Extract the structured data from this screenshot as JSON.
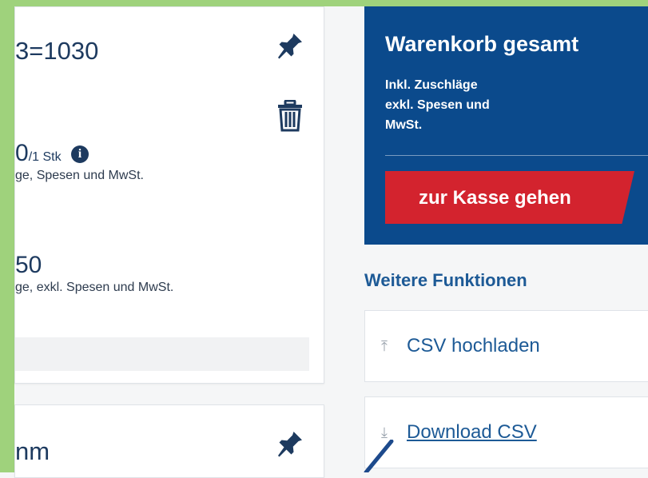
{
  "article_card": {
    "title": "3=1030",
    "unit_price_main": "0",
    "unit_price_unit": "/1 Stk",
    "unit_price_note": "ge, Spesen und MwSt.",
    "total_price": "50",
    "total_price_note": "ge, exkl. Spesen und MwSt.",
    "pin_icon": "pin-icon",
    "trash_icon": "trash-icon",
    "info_icon": "info-icon"
  },
  "second_card": {
    "title": "nm",
    "pin_icon": "pin-icon"
  },
  "cart_summary": {
    "title": "Warenkorb gesamt",
    "note_lines": [
      "Inkl. Zuschläge",
      "exkl. Spesen und",
      "MwSt."
    ],
    "checkout_label": "zur Kasse gehen"
  },
  "functions": {
    "title": "Weitere Funktionen",
    "items": [
      {
        "label": "CSV hochladen",
        "icon": "upload-icon",
        "glyph": "⤒"
      },
      {
        "label": "Download CSV",
        "icon": "download-icon",
        "glyph": "⤓"
      }
    ]
  },
  "colors": {
    "cart_bg": "#0b4a8c",
    "checkout_red": "#d3232e",
    "accent_green": "#9fd27c",
    "link_blue": "#1d5a96"
  }
}
